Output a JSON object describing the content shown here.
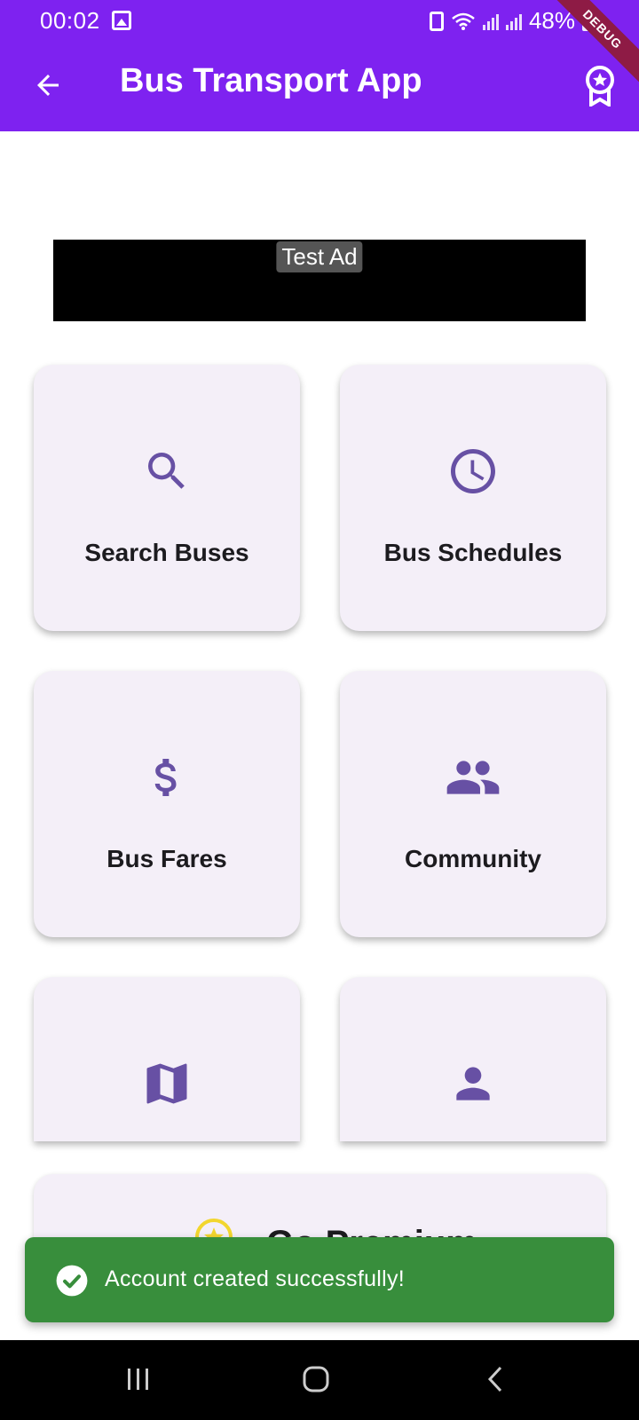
{
  "status_bar": {
    "time": "00:02",
    "battery_percent": "48%",
    "debug_banner": "DEBUG"
  },
  "app_bar": {
    "title": "Bus Transport App",
    "color": "#7E22F0"
  },
  "ad": {
    "label": "Test Ad"
  },
  "cards": [
    {
      "label": "Search Buses",
      "icon": "search-icon"
    },
    {
      "label": "Bus Schedules",
      "icon": "clock-icon"
    },
    {
      "label": "Bus Fares",
      "icon": "dollar-icon"
    },
    {
      "label": "Community",
      "icon": "people-icon"
    },
    {
      "label": "",
      "icon": "map-icon"
    },
    {
      "label": "",
      "icon": "person-icon"
    }
  ],
  "premium": {
    "label": "Go Premium",
    "icon": "star-badge-icon"
  },
  "snackbar": {
    "message": "Account created successfully!",
    "color": "#388E3C"
  },
  "colors": {
    "icon_purple": "#6750A4",
    "card_bg": "#F4EFF8"
  }
}
